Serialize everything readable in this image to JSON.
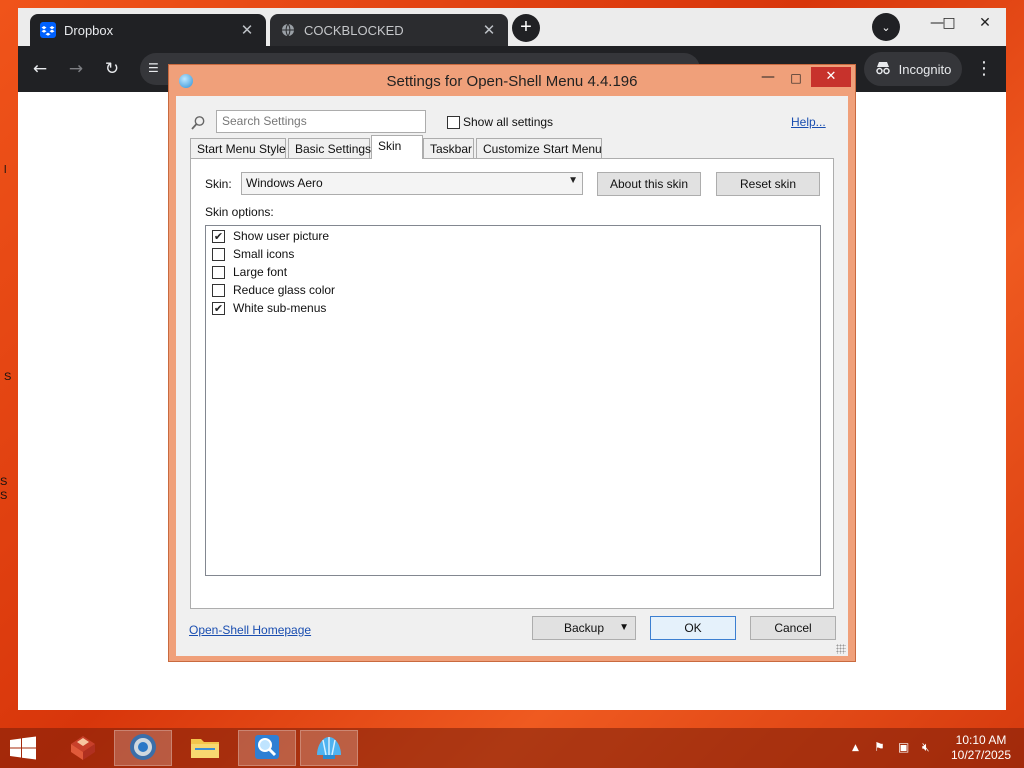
{
  "desktop": {
    "edge_glyphs": [
      "l",
      "S",
      "S",
      "S"
    ]
  },
  "browser": {
    "tabs": [
      {
        "label": "Dropbox",
        "active": true,
        "icon": "dropbox-icon"
      },
      {
        "label": "COCKBLOCKED",
        "active": false,
        "icon": "globe-icon"
      }
    ],
    "new_tab": "+",
    "incognito_label": "Incognito"
  },
  "dialog": {
    "title": "Settings for Open-Shell Menu 4.4.196",
    "search_placeholder": "Search Settings",
    "show_all_label": "Show all settings",
    "show_all_checked": false,
    "help_link": "Help...",
    "tabs": [
      "Start Menu Style",
      "Basic Settings",
      "Skin",
      "Taskbar",
      "Customize Start Menu"
    ],
    "selected_tab": "Skin",
    "skin_label": "Skin:",
    "skin_value": "Windows Aero",
    "about_skin_button": "About this skin",
    "reset_skin_button": "Reset skin",
    "skin_options_label": "Skin options:",
    "options": [
      {
        "label": "Show user picture",
        "checked": true
      },
      {
        "label": "Small icons",
        "checked": false
      },
      {
        "label": "Large font",
        "checked": false
      },
      {
        "label": "Reduce glass color",
        "checked": false
      },
      {
        "label": "White sub-menus",
        "checked": true
      }
    ],
    "homepage_link": "Open-Shell Homepage",
    "backup_button": "Backup",
    "ok_button": "OK",
    "cancel_button": "Cancel"
  },
  "taskbar": {
    "clock_time": "10:10 AM",
    "clock_date": "10/27/2025"
  },
  "colors": {
    "desktop": "#e8410f",
    "dialog_frame": "#f0a07a",
    "close_button": "#c7322c",
    "link": "#1a4eb0",
    "browser_toolbar": "#202124"
  }
}
